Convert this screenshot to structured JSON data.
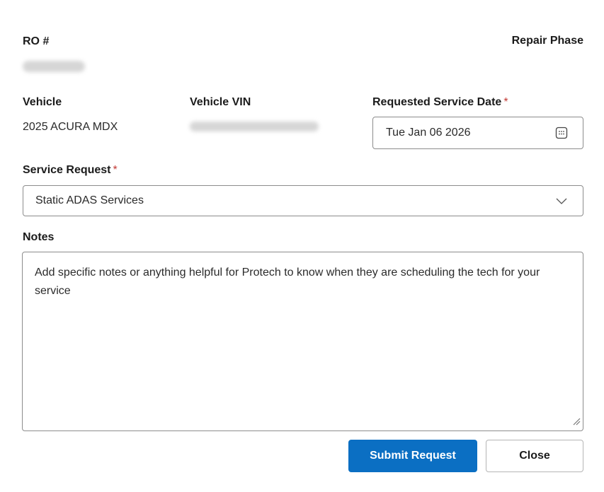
{
  "ro": {
    "label": "RO #",
    "value_redacted": true
  },
  "phase": {
    "label": "Repair Phase"
  },
  "vehicle": {
    "label": "Vehicle",
    "value": "2025 ACURA MDX"
  },
  "vin": {
    "label": "Vehicle VIN",
    "value_redacted": true
  },
  "service_date": {
    "label": "Requested Service Date",
    "required_mark": "*",
    "value": "Tue Jan 06 2026",
    "icon": "calendar-icon"
  },
  "service_request": {
    "label": "Service Request",
    "required_mark": "*",
    "selected": "Static ADAS Services",
    "icon": "chevron-down-icon"
  },
  "notes": {
    "label": "Notes",
    "placeholder": "Add specific notes or anything helpful for Protech to know when they are scheduling the tech for your service"
  },
  "actions": {
    "submit": "Submit Request",
    "close": "Close"
  },
  "colors": {
    "primary": "#0b6fc3",
    "required": "#c23934",
    "border": "#8c8c8c"
  }
}
